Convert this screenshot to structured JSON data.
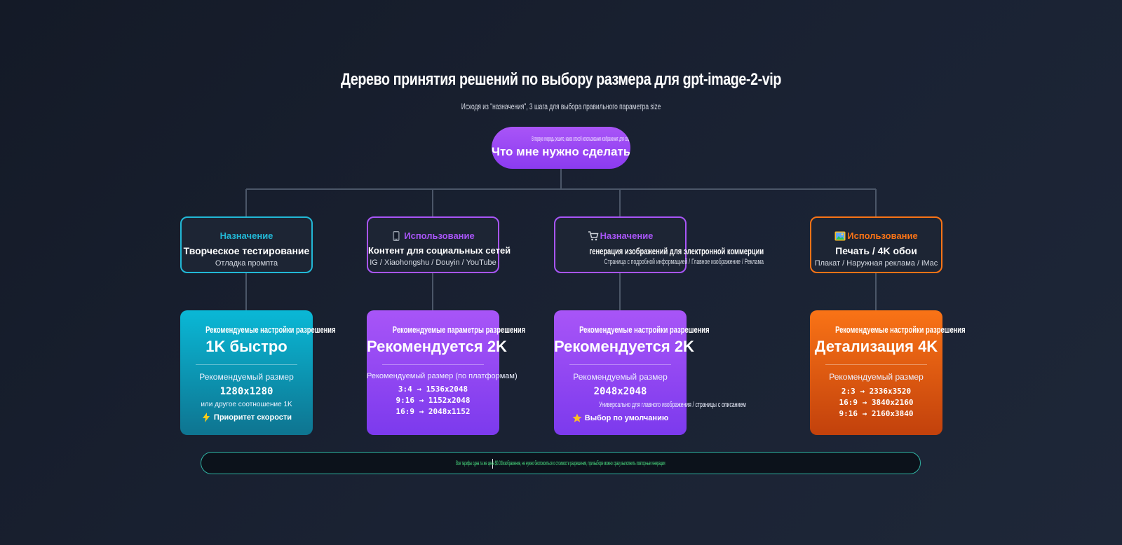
{
  "header": {
    "title": "Дерево принятия решений по выбору размера для gpt-image-2-vip",
    "subtitle": "Исходя из \"назначения\", 3 шага для выбора правильного параметра size"
  },
  "root": {
    "sub": "В первую очередь решите, каков способ использования изображения: для социальных сетей, электронной коммерции, печати или творческих тестов",
    "question": "Что мне нужно сделать?"
  },
  "purposes": [
    {
      "tag": "Назначение",
      "icon": "",
      "title": "Творческое тестирование",
      "desc": "Отладка промпта",
      "color": "#22b8d6"
    },
    {
      "tag": "Использование",
      "icon": "phone-icon",
      "title": "Контент для социальных сетей",
      "desc": "IG / Xiaohongshu / Douyin / YouTube",
      "color": "#a855f7"
    },
    {
      "tag": "Назначение",
      "icon": "cart-icon",
      "title": "генерация изображений для электронной коммерции",
      "desc": "Страница с подробной информацией / Главное изображение / Реклама",
      "color": "#a855f7"
    },
    {
      "tag": "Использование",
      "icon": "picture-icon",
      "title": "Печать / 4K обои",
      "desc": "Плакат / Наружная реклама / iMac",
      "color": "#f97316"
    }
  ],
  "results": [
    {
      "label": "Рекомендуемые настройки разрешения",
      "value": "1K быстро",
      "size_label": "Рекомендуемый размер",
      "sizes": [
        "1280x1280"
      ],
      "note": "или другое соотношение 1K",
      "badge_icon": "lightning-icon",
      "badge": "Приоритет скорости"
    },
    {
      "label": "Рекомендуемые параметры разрешения",
      "value": "Рекомендуется 2K",
      "size_label": "Рекомендуемый размер (по платформам)",
      "sizes": [
        "3:4 → 1536x2048",
        "9:16 → 1152x2048",
        "16:9 → 2048x1152"
      ],
      "note": "",
      "badge_icon": "",
      "badge": ""
    },
    {
      "label": "Рекомендуемые настройки разрешения",
      "value": "Рекомендуется 2K",
      "size_label": "Рекомендуемый размер",
      "sizes": [
        "2048x2048"
      ],
      "note": "Универсально для главного изображения / страницы с описанием",
      "badge_icon": "star-icon",
      "badge": "Выбор по умолчанию"
    },
    {
      "label": "Рекомендуемые настройки разрешения",
      "value": "Детализация 4K",
      "size_label": "Рекомендуемый размер",
      "sizes": [
        "2:3 → 2336x3520",
        "16:9 → 3840x2160",
        "9:16 → 2160x3840"
      ],
      "note": "",
      "badge_icon": "",
      "badge": ""
    }
  ],
  "footer": {
    "text": "Все тарифы одна та же цена $0.03/изображение, не нужно беспокоиться о стоимости разрешения, при выборе можно сразу выполнить повторные генерации"
  },
  "colors": {
    "cyan": "#22b8d6",
    "purple": "#a855f7",
    "orange": "#f97316",
    "footer_border": "#2fb3a3",
    "footer_text": "#4ade80"
  }
}
